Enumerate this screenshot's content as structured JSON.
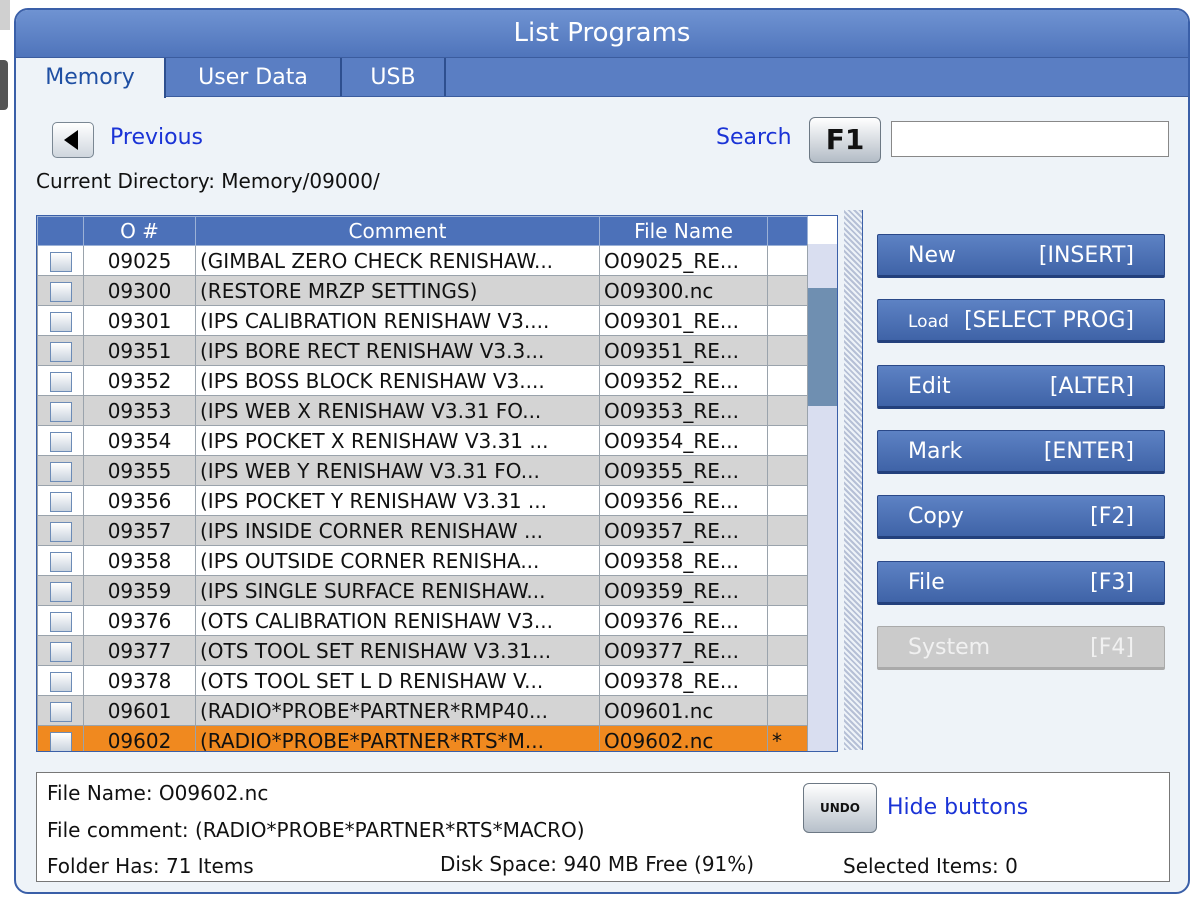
{
  "window": {
    "title": "List Programs"
  },
  "tabs": [
    {
      "label": "Memory",
      "active": true
    },
    {
      "label": "User Data",
      "active": false
    },
    {
      "label": "USB",
      "active": false
    }
  ],
  "nav": {
    "previous_label": "Previous",
    "search_label": "Search",
    "search_key": "F1",
    "search_value": ""
  },
  "current_directory": "Current Directory: Memory/09000/",
  "table": {
    "columns": [
      "",
      "O #",
      "Comment",
      "File Name",
      ""
    ],
    "rows": [
      {
        "onum": "09025",
        "comment": "(GIMBAL ZERO CHECK RENISHAW...",
        "file": "O09025_RE...",
        "mark": ""
      },
      {
        "onum": "09300",
        "comment": "(RESTORE MRZP SETTINGS)",
        "file": "O09300.nc",
        "mark": ""
      },
      {
        "onum": "09301",
        "comment": "(IPS CALIBRATION RENISHAW V3....",
        "file": "O09301_RE...",
        "mark": ""
      },
      {
        "onum": "09351",
        "comment": "(IPS BORE RECT RENISHAW V3.3...",
        "file": "O09351_RE...",
        "mark": ""
      },
      {
        "onum": "09352",
        "comment": "(IPS BOSS BLOCK RENISHAW V3....",
        "file": "O09352_RE...",
        "mark": ""
      },
      {
        "onum": "09353",
        "comment": "(IPS WEB X RENISHAW V3.31 FO...",
        "file": "O09353_RE...",
        "mark": ""
      },
      {
        "onum": "09354",
        "comment": "(IPS POCKET X RENISHAW V3.31 ...",
        "file": "O09354_RE...",
        "mark": ""
      },
      {
        "onum": "09355",
        "comment": "(IPS WEB Y RENISHAW V3.31 FO...",
        "file": "O09355_RE...",
        "mark": ""
      },
      {
        "onum": "09356",
        "comment": "(IPS POCKET Y RENISHAW V3.31 ...",
        "file": "O09356_RE...",
        "mark": ""
      },
      {
        "onum": "09357",
        "comment": "(IPS INSIDE CORNER RENISHAW ...",
        "file": "O09357_RE...",
        "mark": ""
      },
      {
        "onum": "09358",
        "comment": "(IPS OUTSIDE CORNER RENISHA...",
        "file": "O09358_RE...",
        "mark": ""
      },
      {
        "onum": "09359",
        "comment": "(IPS SINGLE SURFACE RENISHAW...",
        "file": "O09359_RE...",
        "mark": ""
      },
      {
        "onum": "09376",
        "comment": "(OTS CALIBRATION RENISHAW V3...",
        "file": "O09376_RE...",
        "mark": ""
      },
      {
        "onum": "09377",
        "comment": "(OTS TOOL SET RENISHAW V3.31...",
        "file": "O09377_RE...",
        "mark": ""
      },
      {
        "onum": "09378",
        "comment": "(OTS TOOL SET L D RENISHAW V...",
        "file": "O09378_RE...",
        "mark": ""
      },
      {
        "onum": "09601",
        "comment": "(RADIO*PROBE*PARTNER*RMP40...",
        "file": "O09601.nc",
        "mark": ""
      },
      {
        "onum": "09602",
        "comment": "(RADIO*PROBE*PARTNER*RTS*M...",
        "file": "O09602.nc",
        "mark": "*",
        "selected": true
      }
    ]
  },
  "side_buttons": [
    {
      "name": "new-button",
      "left": "New",
      "right": "[INSERT]",
      "enabled": true
    },
    {
      "name": "load-button",
      "left": "Load",
      "right": "[SELECT PROG]",
      "enabled": true
    },
    {
      "name": "edit-button",
      "left": "Edit",
      "right": "[ALTER]",
      "enabled": true
    },
    {
      "name": "mark-button",
      "left": "Mark",
      "right": "[ENTER]",
      "enabled": true
    },
    {
      "name": "copy-button",
      "left": "Copy",
      "right": "[F2]",
      "enabled": true
    },
    {
      "name": "file-button",
      "left": "File",
      "right": "[F3]",
      "enabled": true
    },
    {
      "name": "system-button",
      "left": "System",
      "right": "[F4]",
      "enabled": false
    }
  ],
  "info": {
    "file_name": "File Name: O09602.nc",
    "file_comment": "File comment: (RADIO*PROBE*PARTNER*RTS*MACRO)",
    "folder_has": "Folder Has: 71 Items",
    "disk_space": "Disk Space: 940 MB Free (91%)",
    "selected_items": "Selected Items: 0",
    "undo_label": "UNDO",
    "hide_buttons_label": "Hide buttons"
  },
  "icons": {
    "previous": "triangle-left-icon",
    "checkbox": "checkbox-icon"
  },
  "colors": {
    "accent": "#4c71b9",
    "selected_row": "#f0891f",
    "link": "#1a33d6"
  }
}
